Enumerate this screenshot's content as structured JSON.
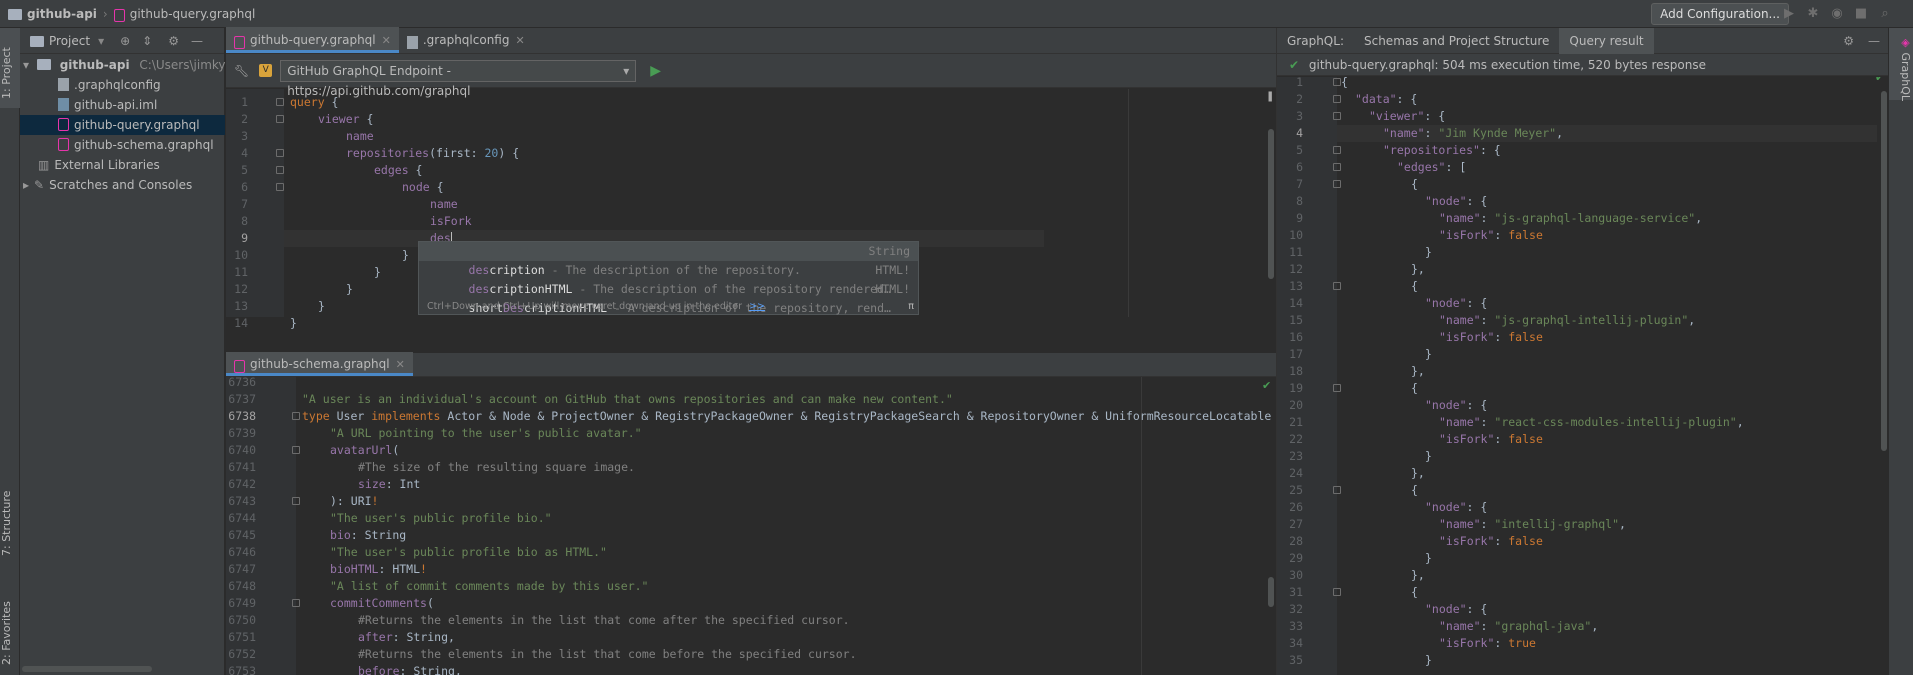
{
  "navbar": {
    "project": "github-api",
    "file": "github-query.graphql",
    "add_config": "Add Configuration..."
  },
  "leftstrip": {
    "project_tab": "1: Project",
    "structure_tab": "7: Structure",
    "favorites_tab": "2: Favorites"
  },
  "project_panel": {
    "header": "Project",
    "root_name": "github-api",
    "root_path": "C:\\Users\\jimky\\Ide",
    "files": [
      ".graphqlconfig",
      "github-api.iml",
      "github-query.graphql",
      "github-schema.graphql"
    ],
    "external_libraries": "External Libraries",
    "scratches": "Scratches and Consoles"
  },
  "editor_tabs": {
    "tab1": "github-query.graphql",
    "tab2": ".graphqlconfig"
  },
  "endpoint": {
    "label": "GitHub GraphQL Endpoint - https://api.github.com/graphql",
    "badge": "V"
  },
  "query_lines": {
    "n": [
      "1",
      "2",
      "3",
      "4",
      "5",
      "6",
      "7",
      "8",
      "9",
      "10",
      "11",
      "12",
      "13",
      "14"
    ],
    "l1k": "query",
    "l1b": " {",
    "l2f": "viewer",
    "l2b": " {",
    "l3f": "name",
    "l4f": "repositories",
    "l4a": "(first: ",
    "l4n": "20",
    "l4b": ") {",
    "l5f": "edges",
    "l5b": " {",
    "l6f": "node",
    "l6b": " {",
    "l7f": "name",
    "l8f": "isFork",
    "l9f": "des",
    "l10": "}",
    "l11": "}",
    "l12": "}",
    "l13": "}",
    "l14": "}"
  },
  "completion": {
    "items": [
      {
        "match": "des",
        "rest": "cription",
        "desc": " - The description of the repository.",
        "type": "String"
      },
      {
        "match": "des",
        "rest": "criptionHTML",
        "desc": " - The description of the repository rendered…",
        "type": "HTML!"
      },
      {
        "pre": "short",
        "match": "Des",
        "rest": "criptionHTML",
        "desc": " - A description of the repository, rend…",
        "type": "HTML!"
      }
    ],
    "hint": "Ctrl+Down and Ctrl+Up will move caret down and up in the editor",
    "hint_link": ">>",
    "pi": "π"
  },
  "schema_tab": "github-schema.graphql",
  "schema_lines": {
    "n": [
      "6736",
      "6737",
      "6738",
      "6739",
      "6740",
      "6741",
      "6742",
      "6743",
      "6744",
      "6745",
      "6746",
      "6747",
      "6748",
      "6749",
      "6750",
      "6751",
      "6752",
      "6753"
    ],
    "l6737": "\"A user is an individual's account on GitHub that owns repositories and can make new content.\"",
    "l6738k": "type",
    "l6738a": " User ",
    "l6738k2": "implements",
    "l6738b": " Actor & Node & ProjectOwner & RegistryPackageOwner & RegistryPackageSearch & RepositoryOwner & UniformResourceLocatable",
    "l6739": "\"A URL pointing to the user's public avatar.\"",
    "l6740f": "avatarUrl",
    "l6740b": "(",
    "l6741": "#The size of the resulting square image.",
    "l6742f": "size",
    "l6742b": ": Int",
    "l6743a": "): URI",
    "l6743b": "!",
    "l6744": "\"The user's public profile bio.\"",
    "l6745f": "bio",
    "l6745b": ": String",
    "l6746": "\"The user's public profile bio as HTML.\"",
    "l6747f": "bioHTML",
    "l6747b": ": HTML",
    "l6748": "\"A list of commit comments made by this user.\"",
    "l6749f": "commitComments",
    "l6749b": "(",
    "l6750": "#Returns the elements in the list that come after the specified cursor.",
    "l6751f": "after",
    "l6751b": ": String,",
    "l6752": "#Returns the elements in the list that come before the specified cursor.",
    "l6753f": "before",
    "l6753b": ": String,"
  },
  "right_panel": {
    "tab_label": "GraphQL:",
    "tab_schemas": "Schemas and Project Structure",
    "tab_result": "Query result",
    "status": "github-query.graphql: 504 ms execution time, 520 bytes response",
    "strip_label": "GraphQL"
  },
  "result_lines": {
    "n": [
      "1",
      "2",
      "3",
      "4",
      "5",
      "6",
      "7",
      "8",
      "9",
      "10",
      "11",
      "12",
      "13",
      "14",
      "15",
      "16",
      "17",
      "18",
      "19",
      "20",
      "21",
      "22",
      "23",
      "24",
      "25",
      "26",
      "27",
      "28",
      "29",
      "30",
      "31",
      "32",
      "33",
      "34",
      "35"
    ],
    "data_key": "\"data\"",
    "viewer_key": "\"viewer\"",
    "name_key": "\"name\"",
    "name_val": "\"Jim Kynde Meyer\"",
    "repos_key": "\"repositories\"",
    "edges_key": "\"edges\"",
    "node_key": "\"node\"",
    "fork_key": "\"isFork\"",
    "repo1": "\"js-graphql-language-service\"",
    "repo2": "\"js-graphql-intellij-plugin\"",
    "repo3": "\"react-css-modules-intellij-plugin\"",
    "repo4": "\"intellij-graphql\"",
    "repo5": "\"graphql-java\"",
    "f": "false",
    "t": "true",
    "ob": "{",
    "cb": "}",
    "cbc": "},",
    "sb": "[",
    "colon": ": ",
    "comma": ","
  }
}
